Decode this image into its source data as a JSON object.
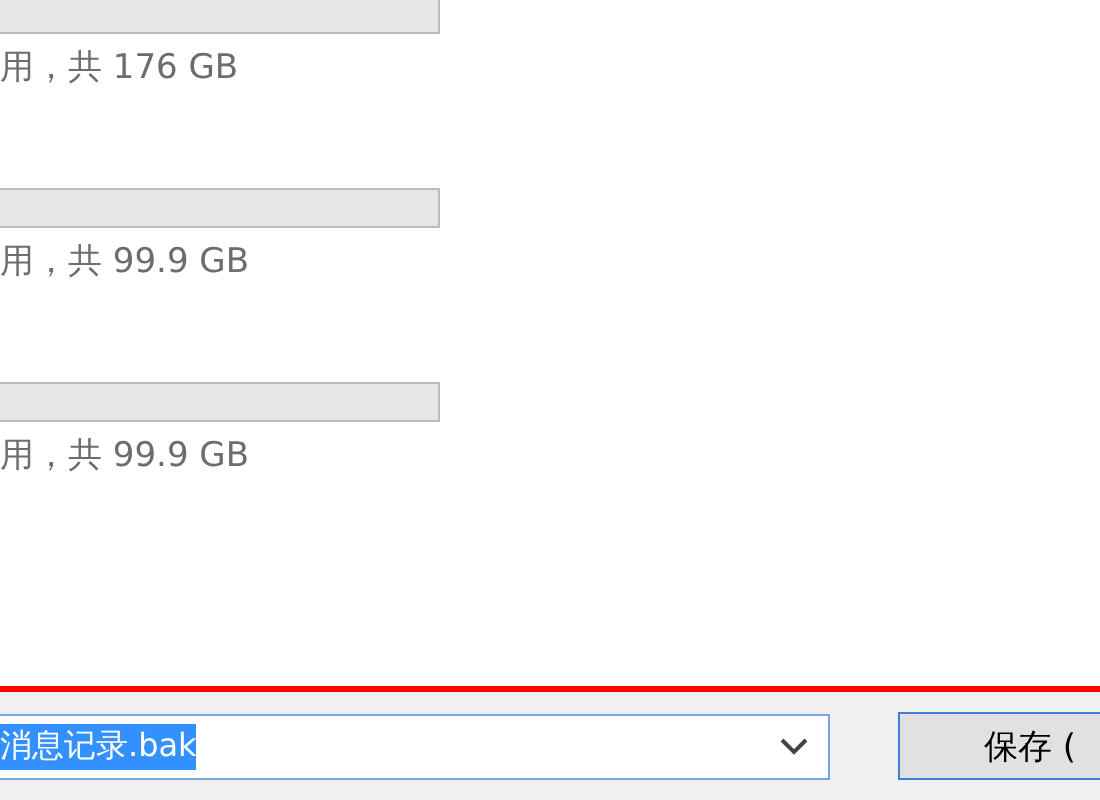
{
  "drives": [
    {
      "usage": "用，共 176 GB"
    },
    {
      "usage": "用，共 99.9 GB"
    },
    {
      "usage": "用，共 99.9 GB"
    }
  ],
  "file_name": {
    "value": "消息记录.bak",
    "selected": true
  },
  "save_button": {
    "label": "保存 ("
  }
}
